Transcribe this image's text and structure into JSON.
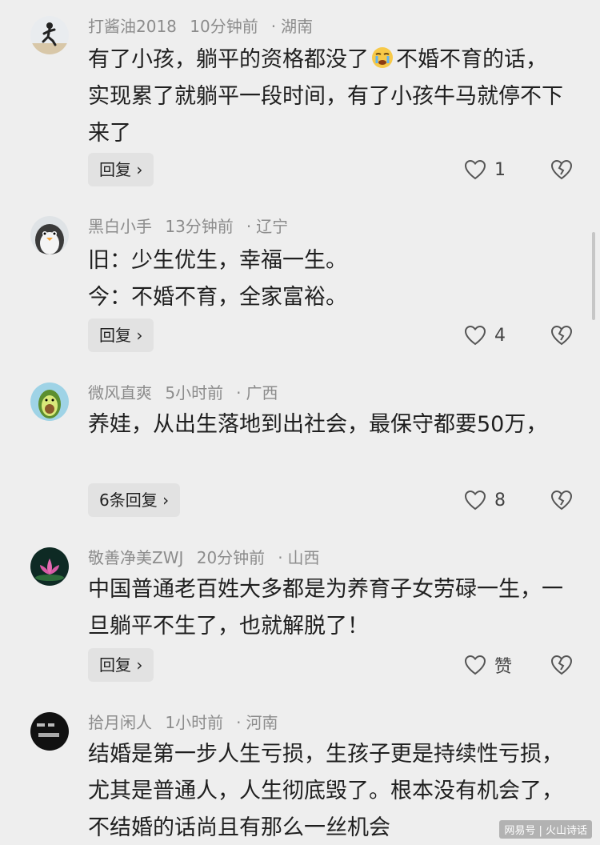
{
  "comments": [
    {
      "user": "打酱油2018",
      "time": "10分钟前",
      "location": "湖南",
      "text_part1": "有了小孩，躺平的资格都没了",
      "text_part2": "不婚不育的话，实现累了就躺平一段时间，有了小孩牛马就停不下来了",
      "reply_label": "回复 ›",
      "likes": "1"
    },
    {
      "user": "黑白小手",
      "time": "13分钟前",
      "location": "辽宁",
      "text_line1": "旧：少生优生，幸福一生。",
      "text_line2": "今：不婚不育，全家富裕。",
      "reply_label": "回复 ›",
      "likes": "4"
    },
    {
      "user": "微风直爽",
      "time": "5小时前",
      "location": "广西",
      "text": "养娃，从出生落地到出社会，最保守都要50万，",
      "reply_label": "6条回复 ›",
      "likes": "8"
    },
    {
      "user": "敬善净美ZWJ",
      "time": "20分钟前",
      "location": "山西",
      "text": "中国普通老百姓大多都是为养育子女劳碌一生，一旦躺平不生了，也就解脱了！",
      "reply_label": "回复 ›",
      "likes": "赞"
    },
    {
      "user": "拾月闲人",
      "time": "1小时前",
      "location": "河南",
      "text": "结婚是第一步人生亏损，生孩子更是持续性亏损，尤其是普通人，人生彻底毁了。根本没有机会了，不结婚的话尚且有那么一丝机会"
    }
  ],
  "watermark": "网易号 | 火山诗话",
  "colors": {
    "background": "#eeeeee",
    "meta_text": "#8c8c8c",
    "body_text": "#1f1f1f",
    "button_bg": "#e2e2e2"
  }
}
